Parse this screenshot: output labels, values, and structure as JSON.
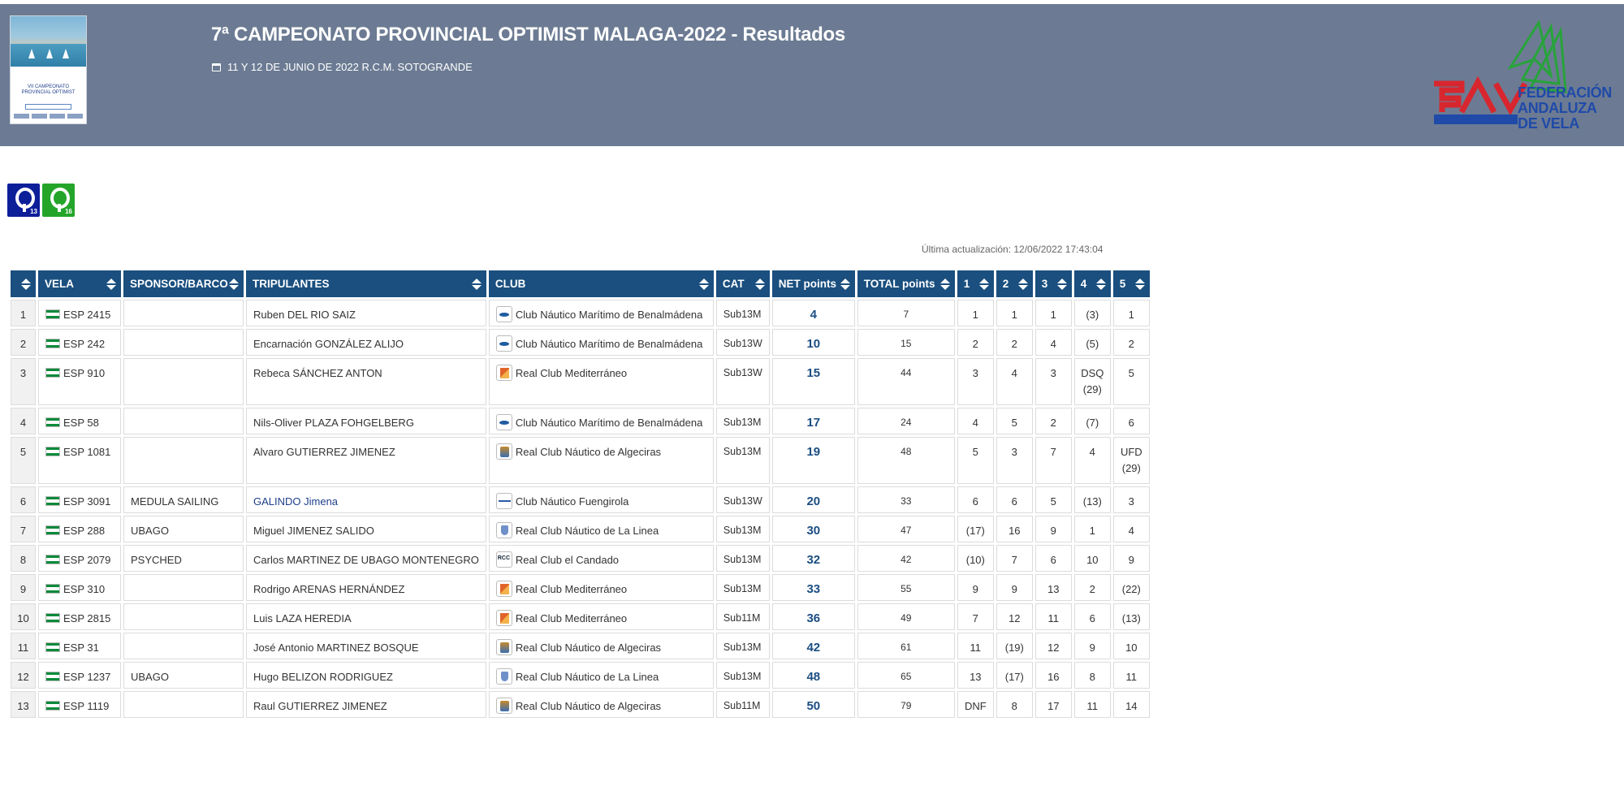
{
  "header": {
    "title": "7ª CAMPEONATO PROVINCIAL OPTIMIST MALAGA-2022 - Resultados",
    "subtitle": "11 Y 12 DE JUNIO DE 2022 R.C.M. SOTOGRANDE",
    "poster_text": "VII CAMPEONATO PROVINCIAL OPTIMIST",
    "federation_logo_text": [
      "FEDERACIÓN",
      "ANDALUZA",
      "DE VELA"
    ]
  },
  "class_filters": [
    {
      "number": "13",
      "color": "#0d1e99",
      "icon": "optimist-icon"
    },
    {
      "number": "16",
      "color": "#24a52a",
      "icon": "optimist-icon"
    }
  ],
  "last_update": "Última actualización: 12/06/2022 17:43:04",
  "table": {
    "columns": [
      "",
      "VELA",
      "SPONSOR/BARCO",
      "TRIPULANTES",
      "CLUB",
      "CAT",
      "NET points",
      "TOTAL points",
      "1",
      "2",
      "3",
      "4",
      "5"
    ],
    "rows": [
      {
        "pos": "1",
        "sail": "ESP 2415",
        "sponsor": "",
        "crew": "Ruben DEL RIO SAIZ",
        "club": "Club Náutico Marítimo de Benalmádena",
        "club_icon": "benal",
        "cat": "Sub13M",
        "net": "4",
        "total": "7",
        "races": [
          "1",
          "1",
          "1",
          "(3)",
          "1"
        ]
      },
      {
        "pos": "2",
        "sail": "ESP 242",
        "sponsor": "",
        "crew": "Encarnación GONZÁLEZ ALIJO",
        "club": "Club Náutico Marítimo de Benalmádena",
        "club_icon": "benal",
        "cat": "Sub13W",
        "net": "10",
        "total": "15",
        "races": [
          "2",
          "2",
          "4",
          "(5)",
          "2"
        ]
      },
      {
        "pos": "3",
        "sail": "ESP 910",
        "sponsor": "",
        "crew": "Rebeca SÁNCHEZ ANTON",
        "club": "Real Club Mediterráneo",
        "club_icon": "medit",
        "cat": "Sub13W",
        "net": "15",
        "total": "44",
        "races": [
          "3",
          "4",
          "3",
          "DSQ (29)",
          "5"
        ]
      },
      {
        "pos": "4",
        "sail": "ESP 58",
        "sponsor": "",
        "crew": "Nils-Oliver PLAZA FOHGELBERG",
        "club": "Club Náutico Marítimo de Benalmádena",
        "club_icon": "benal",
        "cat": "Sub13M",
        "net": "17",
        "total": "24",
        "races": [
          "4",
          "5",
          "2",
          "(7)",
          "6"
        ]
      },
      {
        "pos": "5",
        "sail": "ESP 1081",
        "sponsor": "",
        "crew": "Alvaro GUTIERREZ JIMENEZ",
        "club": "Real Club Náutico de Algeciras",
        "club_icon": "alge",
        "cat": "Sub13M",
        "net": "19",
        "total": "48",
        "races": [
          "5",
          "3",
          "7",
          "4",
          "UFD (29)"
        ]
      },
      {
        "pos": "6",
        "sail": "ESP 3091",
        "sponsor": "MEDULA SAILING",
        "crew": "GALINDO Jimena",
        "crew_link": true,
        "club": "Club Náutico Fuengirola",
        "club_icon": "fueng",
        "cat": "Sub13W",
        "net": "20",
        "total": "33",
        "races": [
          "6",
          "6",
          "5",
          "(13)",
          "3"
        ]
      },
      {
        "pos": "7",
        "sail": "ESP 288",
        "sponsor": "UBAGO",
        "crew": "Miguel JIMENEZ SALIDO",
        "club": "Real Club Náutico de La Linea",
        "club_icon": "linea",
        "cat": "Sub13M",
        "net": "30",
        "total": "47",
        "races": [
          "(17)",
          "16",
          "9",
          "1",
          "4"
        ]
      },
      {
        "pos": "8",
        "sail": "ESP 2079",
        "sponsor": "PSYCHED",
        "crew": "Carlos MARTINEZ DE UBAGO MONTENEGRO",
        "club": "Real Club el Candado",
        "club_icon": "rcc",
        "cat": "Sub13M",
        "net": "32",
        "total": "42",
        "races": [
          "(10)",
          "7",
          "6",
          "10",
          "9"
        ]
      },
      {
        "pos": "9",
        "sail": "ESP 310",
        "sponsor": "",
        "crew": "Rodrigo ARENAS HERNÁNDEZ",
        "club": "Real Club Mediterráneo",
        "club_icon": "medit",
        "cat": "Sub13M",
        "net": "33",
        "total": "55",
        "races": [
          "9",
          "9",
          "13",
          "2",
          "(22)"
        ]
      },
      {
        "pos": "10",
        "sail": "ESP 2815",
        "sponsor": "",
        "crew": "Luis LAZA HEREDIA",
        "club": "Real Club Mediterráneo",
        "club_icon": "medit",
        "cat": "Sub11M",
        "net": "36",
        "total": "49",
        "races": [
          "7",
          "12",
          "11",
          "6",
          "(13)"
        ]
      },
      {
        "pos": "11",
        "sail": "ESP 31",
        "sponsor": "",
        "crew": "José Antonio MARTINEZ BOSQUE",
        "club": "Real Club Náutico de Algeciras",
        "club_icon": "alge",
        "cat": "Sub13M",
        "net": "42",
        "total": "61",
        "races": [
          "11",
          "(19)",
          "12",
          "9",
          "10"
        ]
      },
      {
        "pos": "12",
        "sail": "ESP 1237",
        "sponsor": "UBAGO",
        "crew": "Hugo BELIZON RODRIGUEZ",
        "club": "Real Club Náutico de La Linea",
        "club_icon": "linea",
        "cat": "Sub13M",
        "net": "48",
        "total": "65",
        "races": [
          "13",
          "(17)",
          "16",
          "8",
          "11"
        ]
      },
      {
        "pos": "13",
        "sail": "ESP 1119",
        "sponsor": "",
        "crew": "Raul GUTIERREZ JIMENEZ",
        "club": "Real Club Náutico de Algeciras",
        "club_icon": "alge",
        "cat": "Sub11M",
        "net": "50",
        "total": "79",
        "races": [
          "DNF",
          "8",
          "17",
          "11",
          "14"
        ]
      }
    ]
  }
}
